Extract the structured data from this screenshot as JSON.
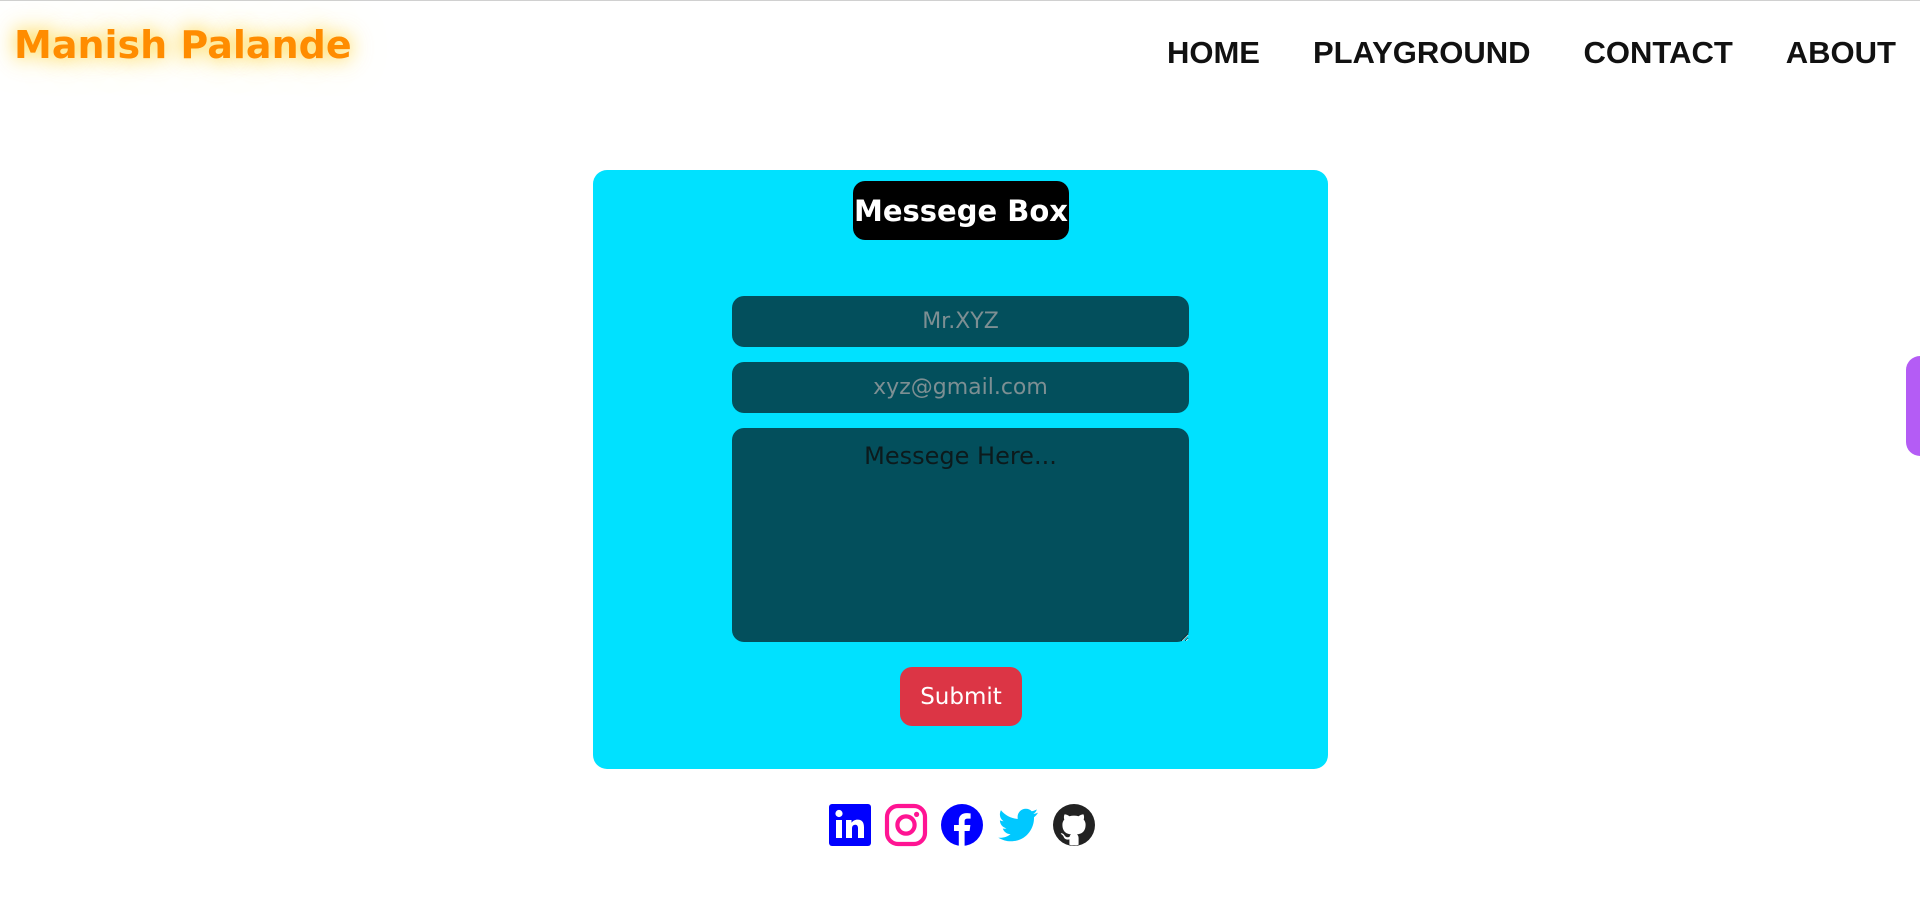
{
  "brand": {
    "name": "Manish Palande",
    "color": "#ff8c00"
  },
  "nav": {
    "items": [
      {
        "label": "HOME"
      },
      {
        "label": "PLAYGROUND"
      },
      {
        "label": "CONTACT"
      },
      {
        "label": "ABOUT"
      }
    ]
  },
  "form": {
    "title": "Messege Box",
    "name_placeholder": "Mr.XYZ",
    "email_placeholder": "xyz@gmail.com",
    "message_placeholder": "Messege Here...",
    "submit_label": "Submit",
    "card_color": "#00e1ff",
    "field_color": "#034f5c",
    "submit_color": "#dc3545"
  },
  "socials": [
    {
      "icon": "linkedin-icon",
      "color": "#0000ff"
    },
    {
      "icon": "instagram-icon",
      "color": "#ff1493"
    },
    {
      "icon": "facebook-icon",
      "color": "#0000ff"
    },
    {
      "icon": "twitter-icon",
      "color": "#00c8ff"
    },
    {
      "icon": "github-icon",
      "color": "#222222"
    }
  ]
}
